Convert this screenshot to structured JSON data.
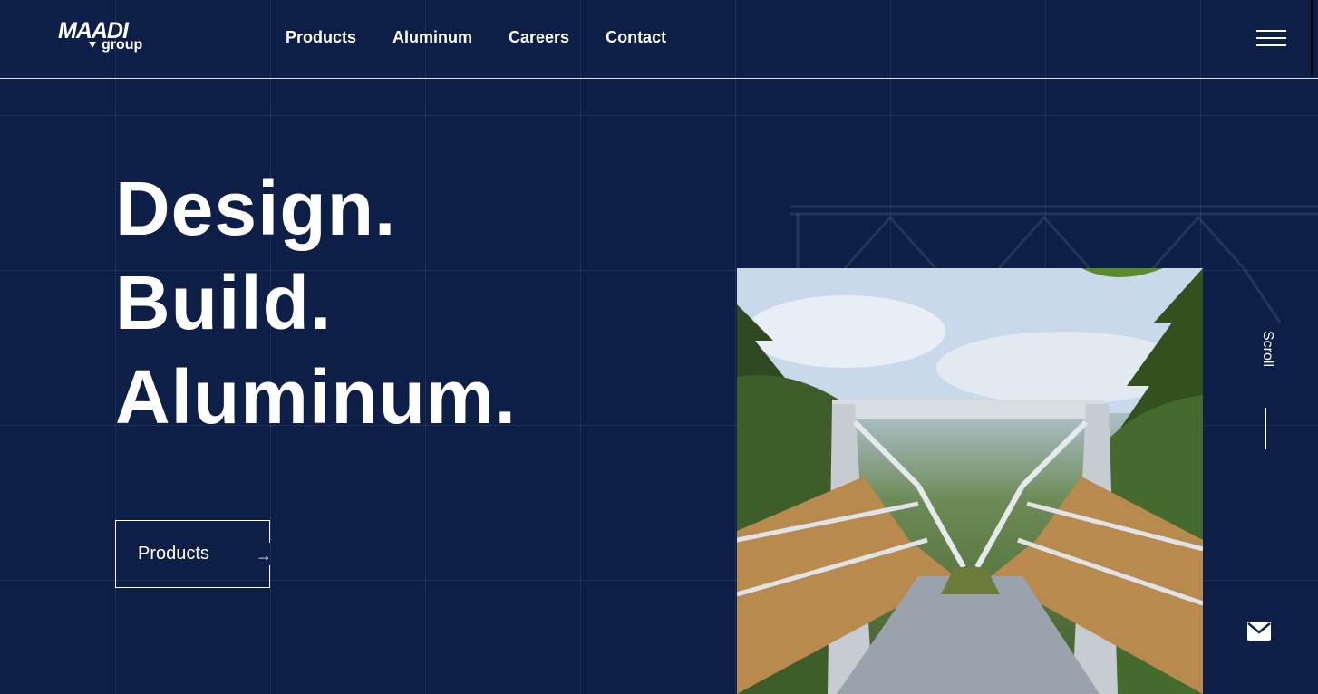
{
  "brand": {
    "logo_top": "MAADI",
    "logo_bottom": "group"
  },
  "nav": {
    "items": [
      {
        "label": "Products"
      },
      {
        "label": "Aluminum"
      },
      {
        "label": "Careers"
      },
      {
        "label": "Contact"
      }
    ]
  },
  "hero": {
    "lines": [
      "Design.",
      "Build.",
      "Aluminum."
    ],
    "cta_label": "Products",
    "cta_arrow": "→"
  },
  "scroll": {
    "label": "Scroll"
  },
  "icons": {
    "menu": "hamburger-menu-icon",
    "mail": "mail-icon",
    "arrow": "arrow-right-icon"
  },
  "colors": {
    "background": "#0d1f47",
    "text": "#ffffff"
  }
}
